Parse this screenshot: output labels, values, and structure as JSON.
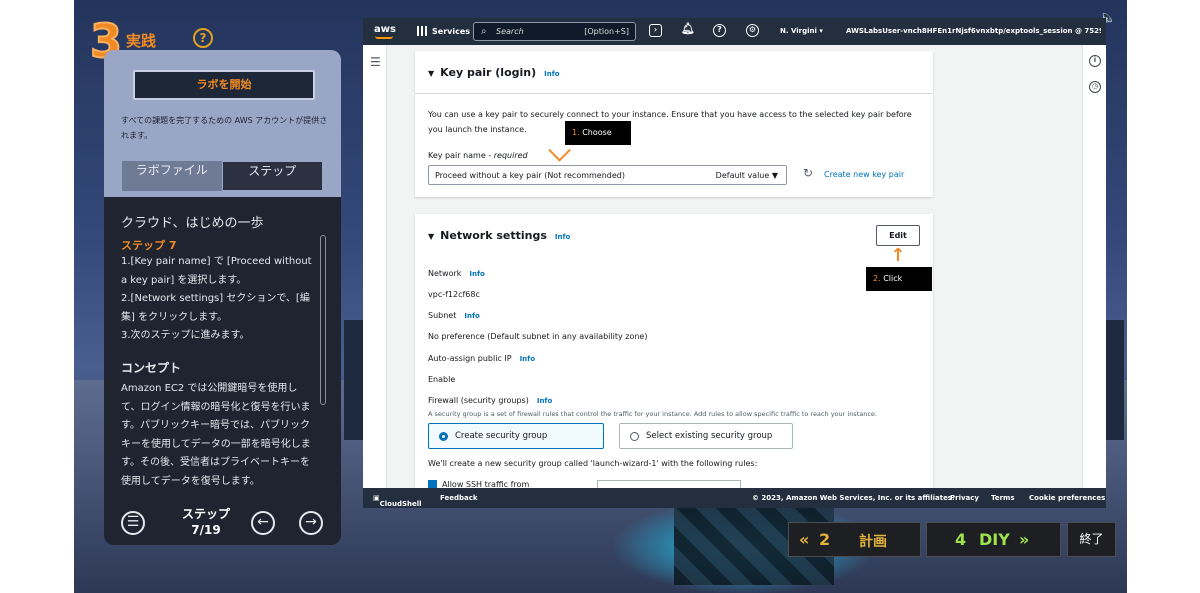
{
  "left_panel": {
    "step_number": "3",
    "step_title": "実践",
    "help": "?",
    "start_lab": "ラボを開始",
    "lab_description": "すべての課題を完了するための AWS アカウントが提供されます。",
    "tabs": [
      "ラボファイル",
      "ステップ"
    ],
    "content_title": "クラウド、はじめの一歩",
    "step_heading": "ステップ 7",
    "instructions": [
      "1.[Key pair name] で [Proceed without a key pair] を選択します。",
      "2.[Network settings] セクションで、[編集] をクリックします。",
      "3.次のステップに進みます。"
    ],
    "concept_heading": "コンセプト",
    "concept_body": "Amazon EC2 では公開鍵暗号を使用して、ログイン情報の暗号化と復号を行います。パブリックキー暗号では、パブリックキーを使用してデータの一部を暗号化します。その後、受信者はプライベートキーを使用してデータを復号します。",
    "step_label": "ステップ",
    "step_counter": "7/19"
  },
  "aws": {
    "logo": "aws",
    "services": "Services",
    "search_placeholder": "Search",
    "search_shortcut": "[Option+S]",
    "region": "N. Virgini ▾",
    "account": "AWSLabsUser-vnch8HFEn1rNjsf6vnxbtp/exptools_session @ 7529- ▾",
    "key_pair": {
      "title": "Key pair (login)",
      "info": "Info",
      "description": "You can use a key pair to securely connect to your instance. Ensure that you have access to the selected key pair before you launch the instance.",
      "name_label": "Key pair name - ",
      "name_required": "required",
      "selected_value": "Proceed without a key pair (Not recommended)",
      "default_value": "Default value ▼",
      "create_link": "Create new key pair"
    },
    "network": {
      "title": "Network settings",
      "info": "Info",
      "edit": "Edit",
      "network_label": "Network",
      "network_value": "vpc-f12cf68c",
      "subnet_label": "Subnet",
      "subnet_value": "No preference (Default subnet in any availability zone)",
      "public_ip_label": "Auto-assign public IP",
      "public_ip_value": "Enable",
      "firewall_label": "Firewall (security groups)",
      "firewall_desc": "A security group is a set of firewall rules that control the traffic for your instance. Add rules to allow specific traffic to reach your instance.",
      "option_create": "Create security group",
      "option_existing": "Select existing security group",
      "rules_intro": "We'll create a new security group called 'launch-wizard-1' with the following rules:",
      "ssh_partial": "Allow SSH traffic from"
    },
    "footer": {
      "cloudshell": "CloudShell",
      "feedback": "Feedback",
      "copyright": "© 2023, Amazon Web Services, Inc. or its affiliates.",
      "privacy": "Privacy",
      "terms": "Terms",
      "cookies": "Cookie preferences"
    }
  },
  "annotations": {
    "choose_num": "1.",
    "choose_text": "Choose",
    "click_num": "2.",
    "click_text": "Click"
  },
  "bottom_nav": {
    "prev_num": "2",
    "prev_label": "計画",
    "next_num": "4",
    "next_label": "DIY",
    "exit": "終了"
  },
  "colors": {
    "accent_orange": "#f08a24",
    "aws_link": "#0073bb",
    "aws_nav": "#232f3e",
    "diy_green": "#9ee24d"
  }
}
